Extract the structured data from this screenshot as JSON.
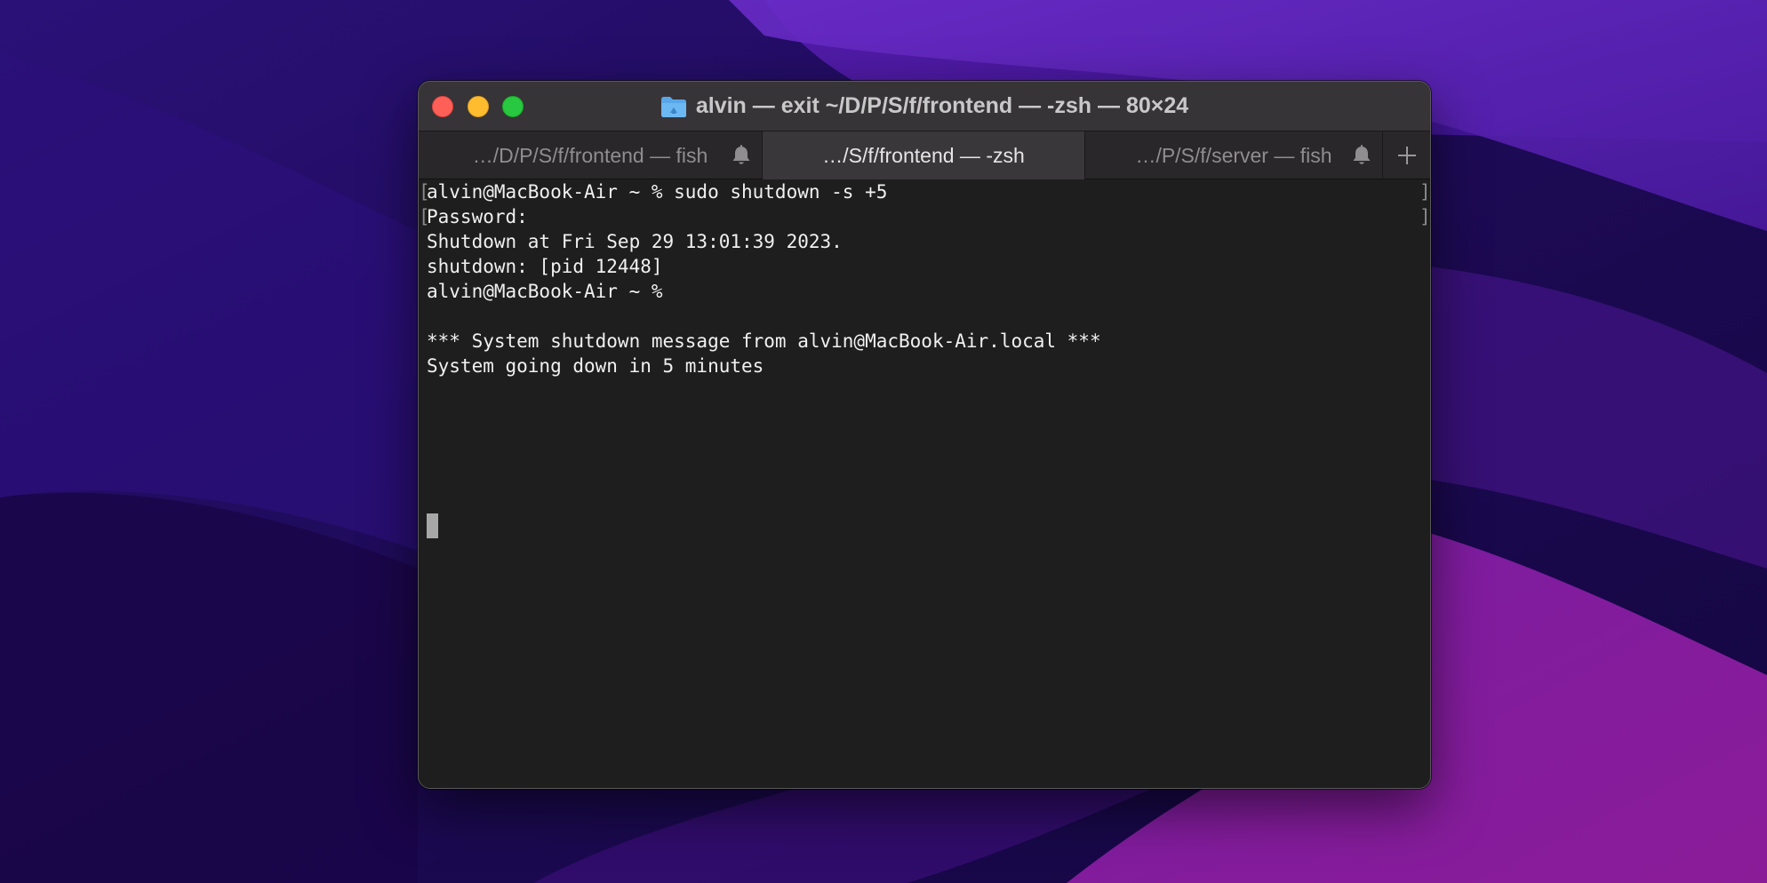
{
  "window": {
    "title": "alvin — exit ~/D/P/S/f/frontend — -zsh — 80×24"
  },
  "tabs": [
    {
      "label": "…/D/P/S/f/frontend — fish",
      "active": false,
      "bell": true
    },
    {
      "label": "…/S/f/frontend — -zsh",
      "active": true,
      "bell": false
    },
    {
      "label": "…/P/S/f/server — fish",
      "active": false,
      "bell": true
    }
  ],
  "terminal": {
    "lines": [
      "alvin@MacBook-Air ~ % sudo shutdown -s +5",
      "Password:",
      "Shutdown at Fri Sep 29 13:01:39 2023.",
      "shutdown: [pid 12448]",
      "alvin@MacBook-Air ~ %",
      "",
      "*** System shutdown message from alvin@MacBook-Air.local ***",
      "System going down in 5 minutes"
    ],
    "mark_left": "[",
    "mark_right": "]"
  },
  "icons": {
    "folder": "folder-icon",
    "bell": "bell-icon",
    "plus": "plus-icon"
  },
  "colors": {
    "close": "#fe5f57",
    "minimize": "#febc2e",
    "zoom": "#28c840",
    "terminal_bg": "#1e1e1e",
    "folder": "#5aa7e8"
  }
}
